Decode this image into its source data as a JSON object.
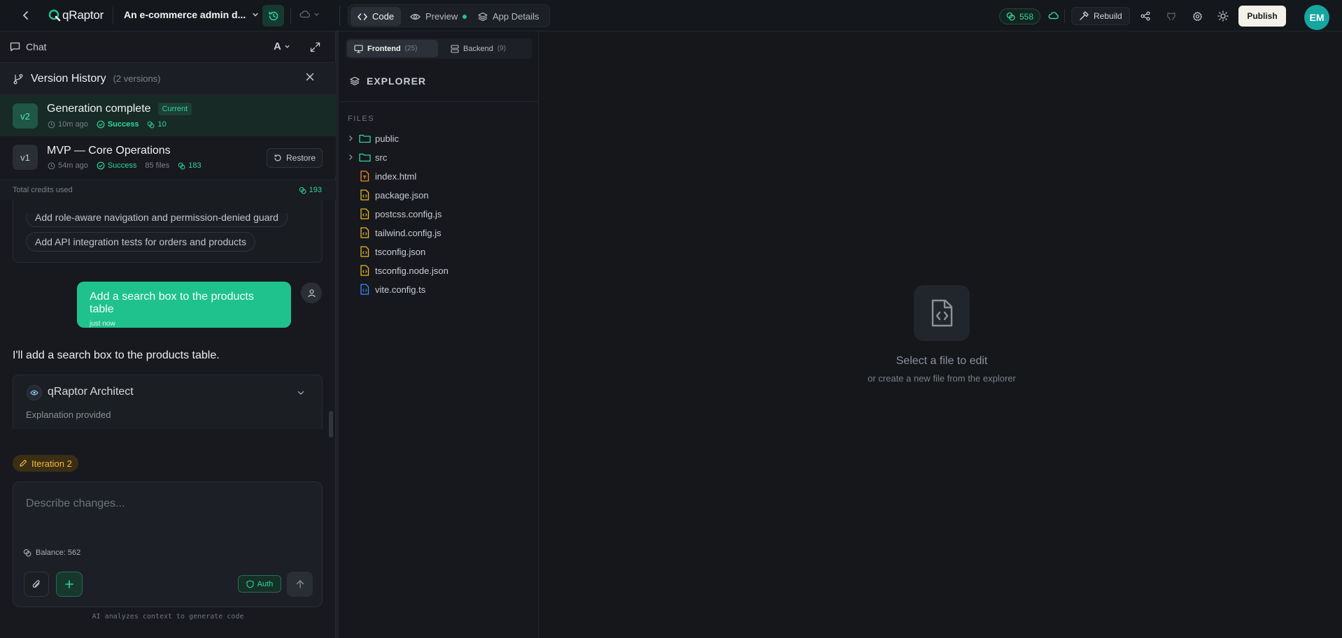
{
  "app": {
    "logo_text": "qRaptor",
    "project_title": "An e-commerce admin d...",
    "modes": [
      {
        "label": "Code",
        "icon": "code-icon",
        "active": true
      },
      {
        "label": "Preview",
        "icon": "eye-icon",
        "active": false,
        "live": true
      },
      {
        "label": "App Details",
        "icon": "layers-icon",
        "active": false
      }
    ],
    "credits": "558",
    "rebuild_label": "Rebuild",
    "publish_label": "Publish",
    "user_initials": "EM",
    "colors": {
      "accent": "#1fc28c",
      "publish_bg": "#f3f1e8",
      "avatar_bg": "#16a6a0",
      "iteration": "#f4b63c"
    }
  },
  "chat": {
    "header_label": "Chat",
    "font_toggle": "A",
    "suggestions": [
      "Add role-aware navigation and permission-denied guard",
      "Add API integration tests for orders and products"
    ],
    "user_message": {
      "text": "Add a search box to the products table",
      "time": "just now"
    },
    "ai_message": "I'll add a search box to the products table.",
    "architect": {
      "title": "qRaptor Architect",
      "subtitle": "Explanation provided"
    },
    "iteration_label": "Iteration 2",
    "composer": {
      "placeholder": "Describe changes...",
      "value": ""
    },
    "balance_label": "Balance: 562",
    "auth_label": "Auth",
    "footer_note": "AI analyzes context to generate code"
  },
  "version_history": {
    "title": "Version History",
    "count_label": "(2 versions)",
    "versions": [
      {
        "badge": "v2",
        "name": "Generation complete",
        "tag": "Current",
        "time": "10m ago",
        "status": "Success",
        "files": "",
        "credits": "10"
      },
      {
        "badge": "v1",
        "name": "MVP — Core Operations",
        "tag": "",
        "time": "54m ago",
        "status": "Success",
        "files": "85 files",
        "credits": "183",
        "action": "Restore"
      }
    ],
    "total_label": "Total credits used",
    "total_value": "193"
  },
  "explorer": {
    "tabs": [
      {
        "label": "Frontend",
        "count": "(25)",
        "active": true
      },
      {
        "label": "Backend",
        "count": "(9)",
        "active": false
      }
    ],
    "title": "EXPLORER",
    "files_label": "FILES",
    "entries": [
      {
        "name": "public",
        "type": "folder"
      },
      {
        "name": "src",
        "type": "folder"
      },
      {
        "name": "index.html",
        "type": "html"
      },
      {
        "name": "package.json",
        "type": "json"
      },
      {
        "name": "postcss.config.js",
        "type": "js"
      },
      {
        "name": "tailwind.config.js",
        "type": "js"
      },
      {
        "name": "tsconfig.json",
        "type": "json"
      },
      {
        "name": "tsconfig.node.json",
        "type": "json"
      },
      {
        "name": "vite.config.ts",
        "type": "ts"
      }
    ]
  },
  "editor": {
    "empty_title": "Select a file to edit",
    "empty_subtitle": "or create a new file from the explorer"
  }
}
